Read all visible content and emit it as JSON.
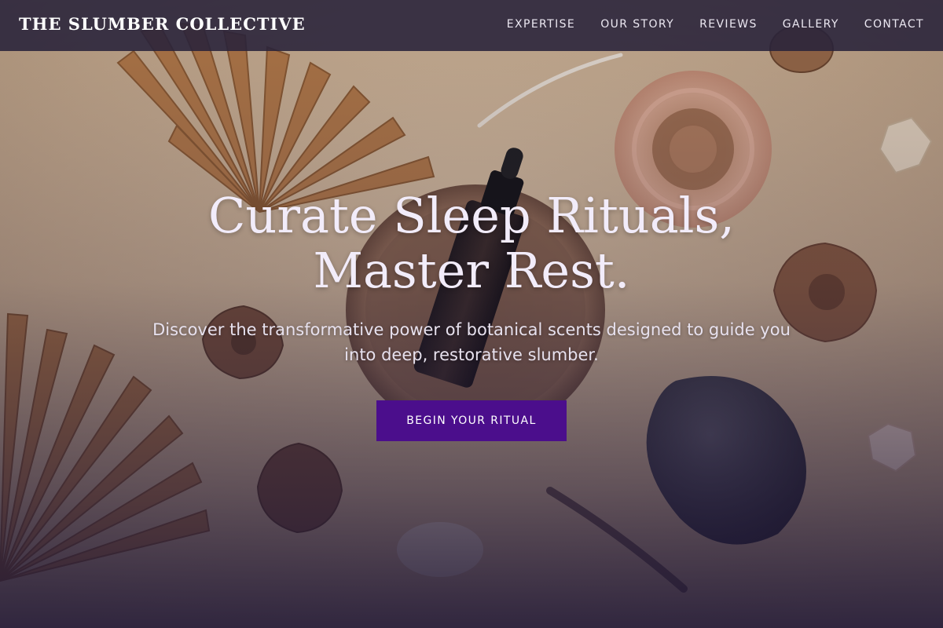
{
  "nav": {
    "brand": "THE SLUMBER COLLECTIVE",
    "links": [
      "EXPERTISE",
      "OUR STORY",
      "REVIEWS",
      "GALLERY",
      "CONTACT"
    ]
  },
  "hero": {
    "title_line1": "Curate Sleep Rituals,",
    "title_line2": "Master Rest.",
    "subtitle": "Discover the transformative power of botanical scents designed to guide you into deep, restorative slumber.",
    "cta_label": "BEGIN YOUR RITUAL"
  },
  "colors": {
    "nav_background": "#28223a",
    "cta_background": "#4b0e8c",
    "background_beige": "#cdb597",
    "text_light": "#f2ecfa"
  }
}
